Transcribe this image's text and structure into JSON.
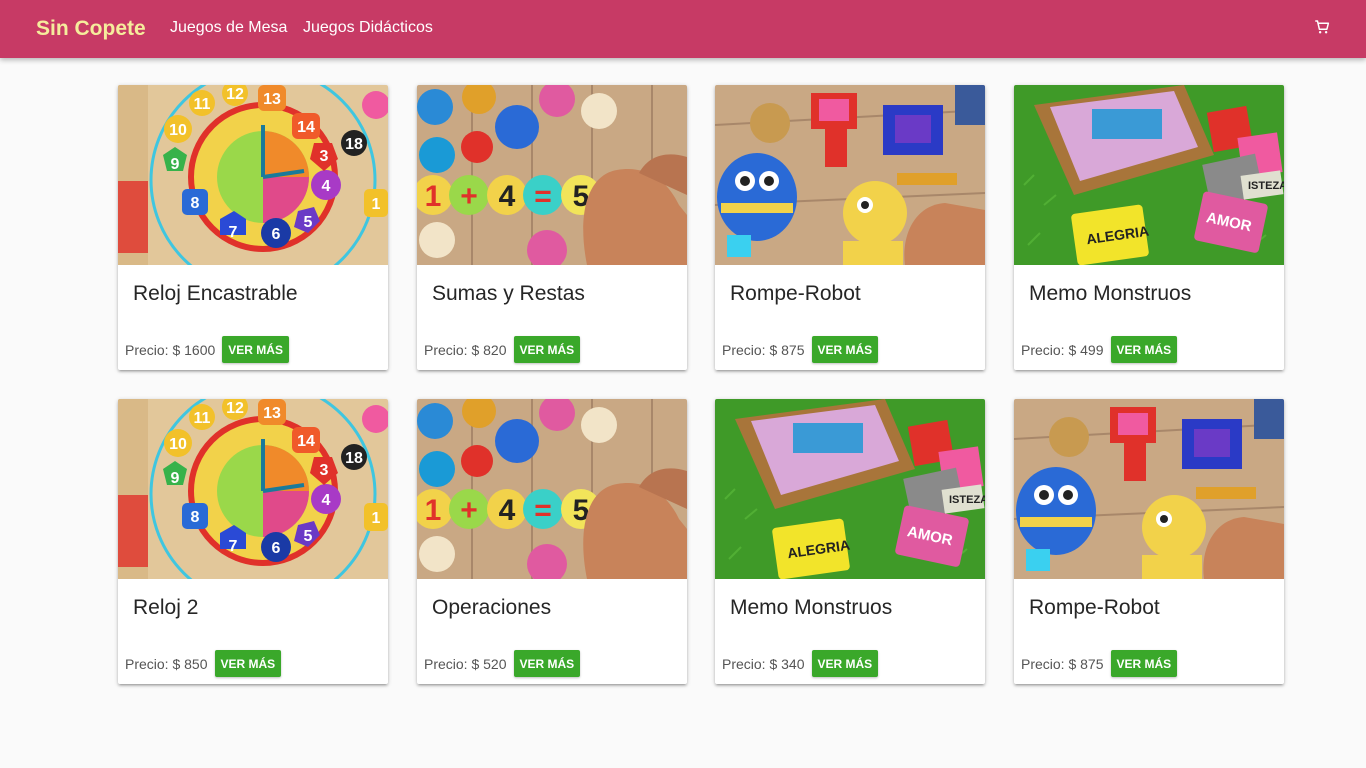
{
  "nav": {
    "brand": "Sin Copete",
    "links": [
      "Juegos de Mesa",
      "Juegos Didácticos"
    ],
    "cart_icon": "cart-icon"
  },
  "colors": {
    "navbar": "#c73a65",
    "brand": "#f5ec9c",
    "button": "#3aa82a"
  },
  "products": [
    {
      "title": "Reloj Encastrable",
      "price": "Precio: $ 1600",
      "button": "VER MÁS",
      "image": "clock-puzzle"
    },
    {
      "title": "Sumas y Restas",
      "price": "Precio: $ 820",
      "button": "VER MÁS",
      "image": "math-puzzle"
    },
    {
      "title": "Rompe-Robot",
      "price": "Precio: $ 875",
      "button": "VER MÁS",
      "image": "robot-puzzle"
    },
    {
      "title": "Memo Monstruos",
      "price": "Precio: $ 499",
      "button": "VER MÁS",
      "image": "memo-cards"
    },
    {
      "title": "Reloj 2",
      "price": "Precio: $ 850",
      "button": "VER MÁS",
      "image": "clock-puzzle"
    },
    {
      "title": "Operaciones",
      "price": "Precio: $ 520",
      "button": "VER MÁS",
      "image": "math-puzzle"
    },
    {
      "title": "Memo Monstruos",
      "price": "Precio: $ 340",
      "button": "VER MÁS",
      "image": "memo-cards"
    },
    {
      "title": "Rompe-Robot",
      "price": "Precio: $ 875",
      "button": "VER MÁS",
      "image": "robot-puzzle"
    }
  ]
}
